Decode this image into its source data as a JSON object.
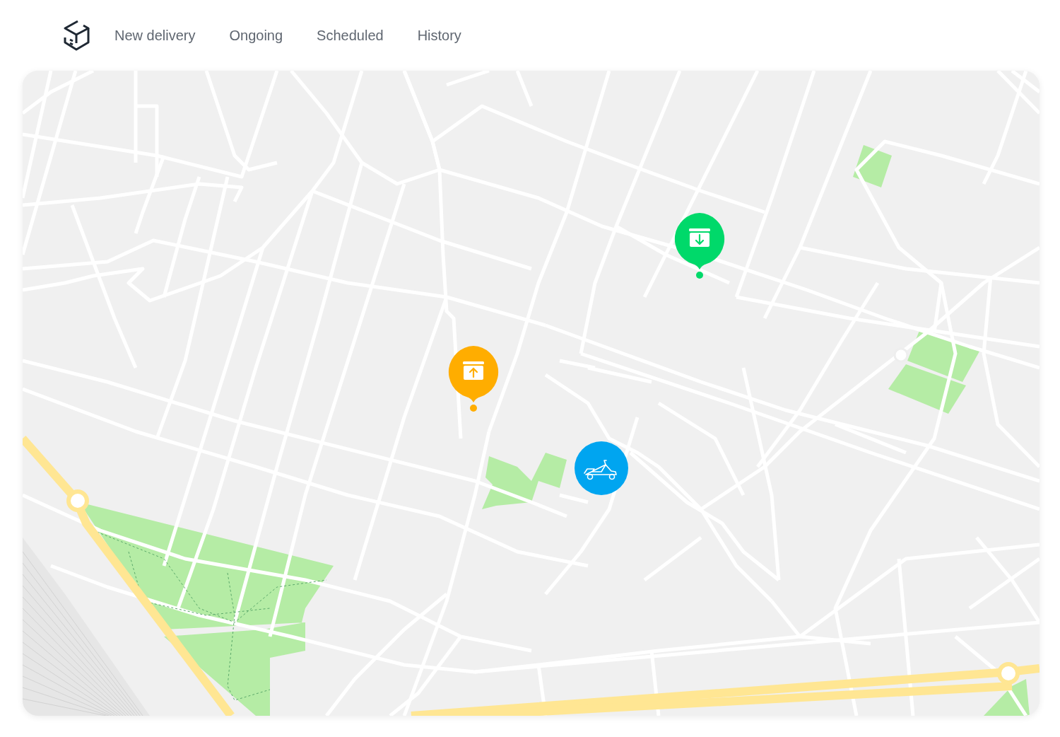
{
  "nav": {
    "items": [
      {
        "label": "New delivery"
      },
      {
        "label": "Ongoing"
      },
      {
        "label": "Scheduled"
      },
      {
        "label": "History"
      }
    ]
  },
  "map": {
    "markers": [
      {
        "kind": "dropoff",
        "color": "#00d96a"
      },
      {
        "kind": "pickup",
        "color": "#ffad00"
      },
      {
        "kind": "courier",
        "color": "#00a5f0"
      }
    ]
  }
}
